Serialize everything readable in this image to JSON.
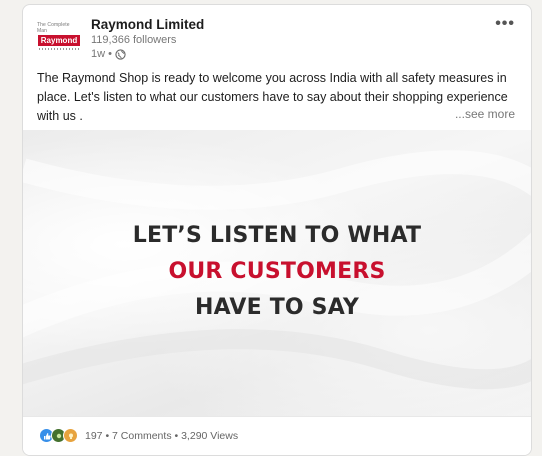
{
  "post": {
    "company": "Raymond Limited",
    "followers": "119,366 followers",
    "time": "1w •",
    "body": "The Raymond Shop is ready to welcome you across India with all safety measures in place. Let's listen to what our customers have to say about their shopping experience with us .",
    "see_more": "...see more",
    "more_glyph": "•••"
  },
  "logo": {
    "tagline": "The Complete Man",
    "brand": "Raymond"
  },
  "media": {
    "line1": "LET’S LISTEN TO WHAT",
    "line2": "OUR CUSTOMERS",
    "line3": "HAVE  TO SAY"
  },
  "footer": {
    "reactions_count": "197",
    "sep1": " • ",
    "comments": "7 Comments",
    "sep2": " • ",
    "views": "3,290 Views"
  },
  "colors": {
    "accent_red": "#c8102e",
    "like_blue": "#378fe9"
  },
  "icons": [
    "logo",
    "globe-icon",
    "more-icon",
    "like-icon",
    "celebrate-icon",
    "insight-icon"
  ]
}
